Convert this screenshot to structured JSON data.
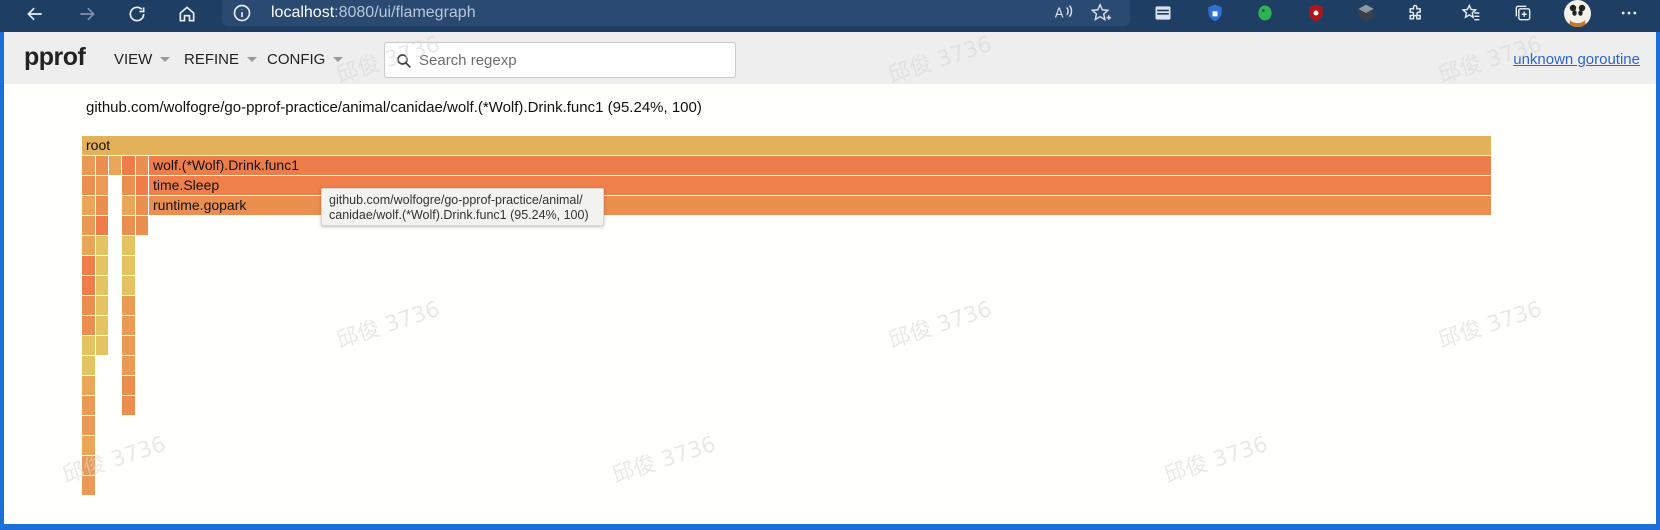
{
  "browser": {
    "url_host": "localhost",
    "url_rest": ":8080/ui/flamegraph",
    "toolbar_icons": [
      "back-icon",
      "forward-icon",
      "refresh-icon",
      "home-icon",
      "info-icon",
      "read-aloud-icon",
      "favorite-add-icon"
    ],
    "extension_icons": [
      "tab-icon",
      "shield-icon",
      "evernote-icon",
      "ublock-icon",
      "cube-icon",
      "puzzle-icon",
      "favorites-icon",
      "collections-icon",
      "avatar",
      "more-icon"
    ],
    "read_aloud_label": "A"
  },
  "app": {
    "brand": "pprof",
    "menus": [
      {
        "label": "VIEW"
      },
      {
        "label": "REFINE"
      },
      {
        "label": "CONFIG"
      }
    ],
    "search": {
      "placeholder": "Search regexp",
      "value": ""
    },
    "goroutine_link": "unknown goroutine",
    "details": "github.com/wolfogre/go-pprof-practice/animal/canidae/wolf.(*Wolf).Drink.func1 (95.24%, 100)"
  },
  "flamegraph": {
    "frames": [
      {
        "label": "root"
      },
      {
        "label": "wolf.(*Wolf).Drink.func1"
      },
      {
        "label": "time.Sleep"
      },
      {
        "label": "runtime.gopark"
      }
    ],
    "tooltip": {
      "line1": "github.com/wolfogre/go-pprof-practice/animal/",
      "line2": "canidae/wolf.(*Wolf).Drink.func1 (95.24%, 100)"
    },
    "colors": {
      "root": "#e2b15a",
      "hot": "#ee7d4c",
      "warm": "#ea8f50",
      "mid": "#e9a659",
      "yellow": "#e4c362"
    }
  },
  "watermark": "邱俊 3736"
}
